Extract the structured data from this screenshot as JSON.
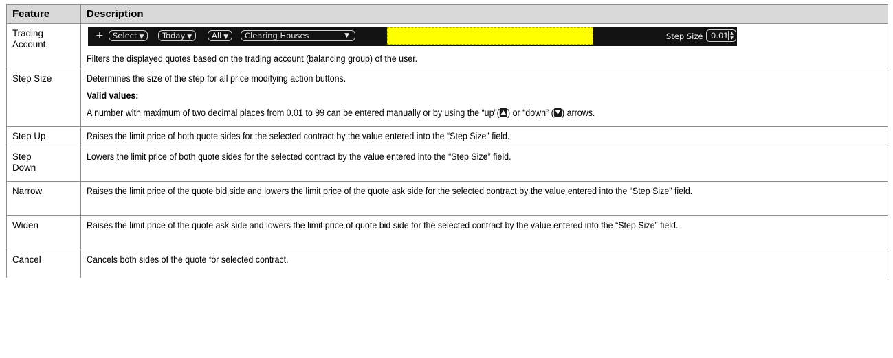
{
  "table": {
    "headers": {
      "feature": "Feature",
      "description": "Description"
    },
    "rows": {
      "trading_account": {
        "feature": "Trading Account",
        "toolbar": {
          "plus": "+",
          "select": "Select",
          "today": "Today",
          "all": "All",
          "clearing_houses": "Clearing Houses",
          "step_size_label": "Step Size",
          "step_size_value": "0.01",
          "highlight_color": "#ffff00"
        },
        "description": "Filters the displayed quotes based on the trading account (balancing group) of the user."
      },
      "step_size": {
        "feature": "Step Size",
        "description": "Determines the size of the step for all price modifying action buttons.",
        "valid_values_label": "Valid values:",
        "valid_values_text_1": "A number with maximum of two decimal places from 0.01 to 99 can be entered manually or by using the “up”(",
        "valid_values_text_2": ") or “down” (",
        "valid_values_text_3": ") arrows.",
        "up_icon": "up-arrow-icon",
        "down_icon": "down-arrow-icon"
      },
      "step_up": {
        "feature": "Step Up",
        "description": "Raises the limit price of both quote sides for the selected contract by the value entered into the “Step Size” field."
      },
      "step_down": {
        "feature": "Step Down",
        "description": "Lowers the limit price of both quote sides for the selected contract by the value entered into the “Step Size” field."
      },
      "narrow": {
        "feature": "Narrow",
        "description": "Raises the limit price of the quote bid side and lowers the limit price of the quote ask side for the selected contract by the value entered into the “Step Size” field."
      },
      "widen": {
        "feature": "Widen",
        "description": "Raises the limit price of the quote ask side and lowers the limit price of quote bid side for the selected contract by the value entered into the “Step Size” field."
      },
      "cancel": {
        "feature": "Cancel",
        "description": "Cancels both sides of the quote for selected contract."
      }
    }
  }
}
